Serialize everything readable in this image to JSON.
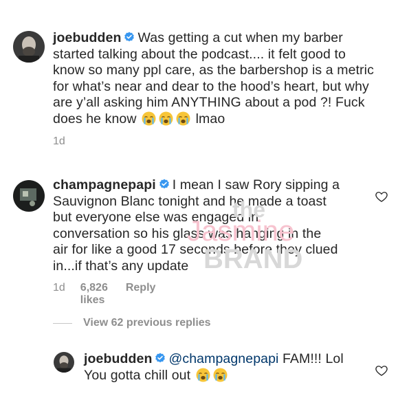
{
  "caption": {
    "username": "joebudden",
    "text_line1": "Was getting a cut when my barber",
    "text_line2": "started talking about the podcast.... it felt good to",
    "text_line3": "know so many ppl care, as the barbershop is a metric",
    "text_line4": "for what’s near and dear to the hood’s heart, but why",
    "text_line5": "are y’all asking him ANYTHING about a pod ?! Fuck",
    "text_line6_prefix": "does he know",
    "text_line6_suffix": "lmao",
    "timestamp": "1d"
  },
  "comment1": {
    "username": "champagnepapi",
    "text_line1": "I mean I saw Rory sipping a",
    "text_line2": "Sauvignon Blanc tonight and he made a toast",
    "text_line3": "but everyone else was engaged in",
    "text_line4": "conversation so his glass was hanging in the",
    "text_line5": "air for like a good 17 seconds before they clued",
    "text_line6": "in...if that’s any update",
    "timestamp": "1d",
    "likes": "6,826 likes",
    "reply": "Reply"
  },
  "replies_toggle": "View 62 previous replies",
  "comment2": {
    "username": "joebudden",
    "mention": "@champagnepapi",
    "text_after_mention": "FAM!!! Lol",
    "text_line2": "You gotta chill out"
  },
  "watermark": {
    "line1": "the",
    "line2": "Jasmine",
    "line3": "BRAND"
  },
  "colors": {
    "text": "#262626",
    "secondary": "#8e8e8e",
    "mention": "#00376b",
    "verified": "#3897f0",
    "watermark_pink": "#f7c3cf",
    "watermark_gray": "#d8d8d8"
  },
  "icons": {
    "verified": "verified-badge-icon",
    "heart": "heart-outline-icon",
    "emoji": "loudly-crying-face-emoji"
  }
}
